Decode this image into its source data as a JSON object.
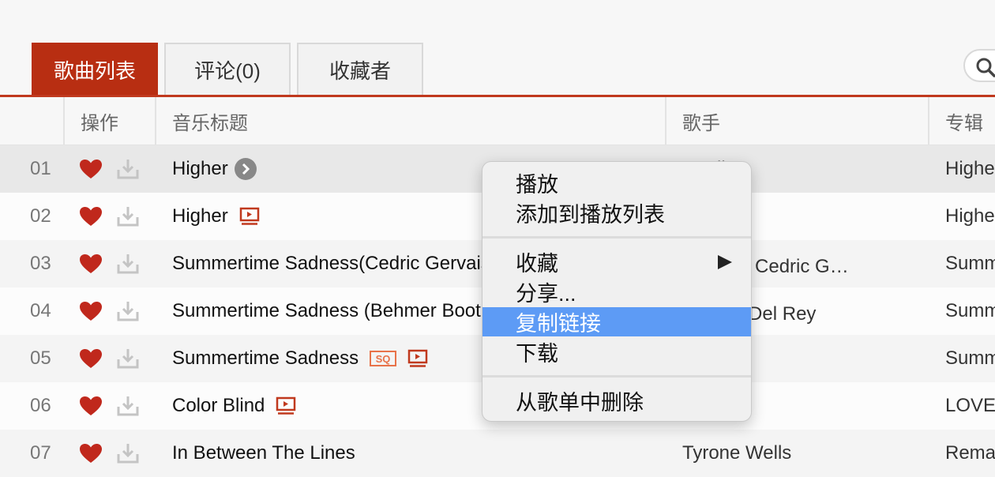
{
  "tabs": [
    {
      "label": "歌曲列表"
    },
    {
      "label": "评论(0)"
    },
    {
      "label": "收藏者"
    }
  ],
  "table": {
    "headers": {
      "action": "操作",
      "title": "音乐标题",
      "artist": "歌手",
      "album": "专辑"
    },
    "rows": [
      {
        "num": "01",
        "title": "Higher",
        "artist": "nwall",
        "album": "Highe"
      },
      {
        "num": "02",
        "title": "Higher",
        "artist": "",
        "album": "Highe"
      },
      {
        "num": "03",
        "title": "Summertime Sadness(Cedric Gervais",
        "artist": "l Rey ， Cedric G…",
        "album": "Summ"
      },
      {
        "num": "04",
        "title": "Summertime Sadness (Behmer Boot",
        "artist": "，Lana Del Rey",
        "album": "Summ"
      },
      {
        "num": "05",
        "title": "Summertime Sadness",
        "artist": "l Rey",
        "album": "Summ"
      },
      {
        "num": "06",
        "title": "Color Blind",
        "artist": "",
        "album": "LOVE"
      },
      {
        "num": "07",
        "title": "In Between The Lines",
        "artist": "Tyrone Wells",
        "album": "Rema"
      }
    ]
  },
  "badges": {
    "sq": "SQ"
  },
  "context_menu": {
    "items": [
      "播放",
      "添加到播放列表",
      "收藏",
      "分享...",
      "复制链接",
      "下载",
      "从歌单中删除"
    ],
    "selected": "复制链接"
  },
  "colors": {
    "accent": "#b82e12",
    "heart": "#c0281c",
    "selection": "#5d9bf5"
  },
  "icons": [
    "search-icon",
    "heart-icon",
    "download-icon",
    "mv-icon",
    "sq-badge",
    "play-circle-icon",
    "submenu-arrow-icon"
  ]
}
